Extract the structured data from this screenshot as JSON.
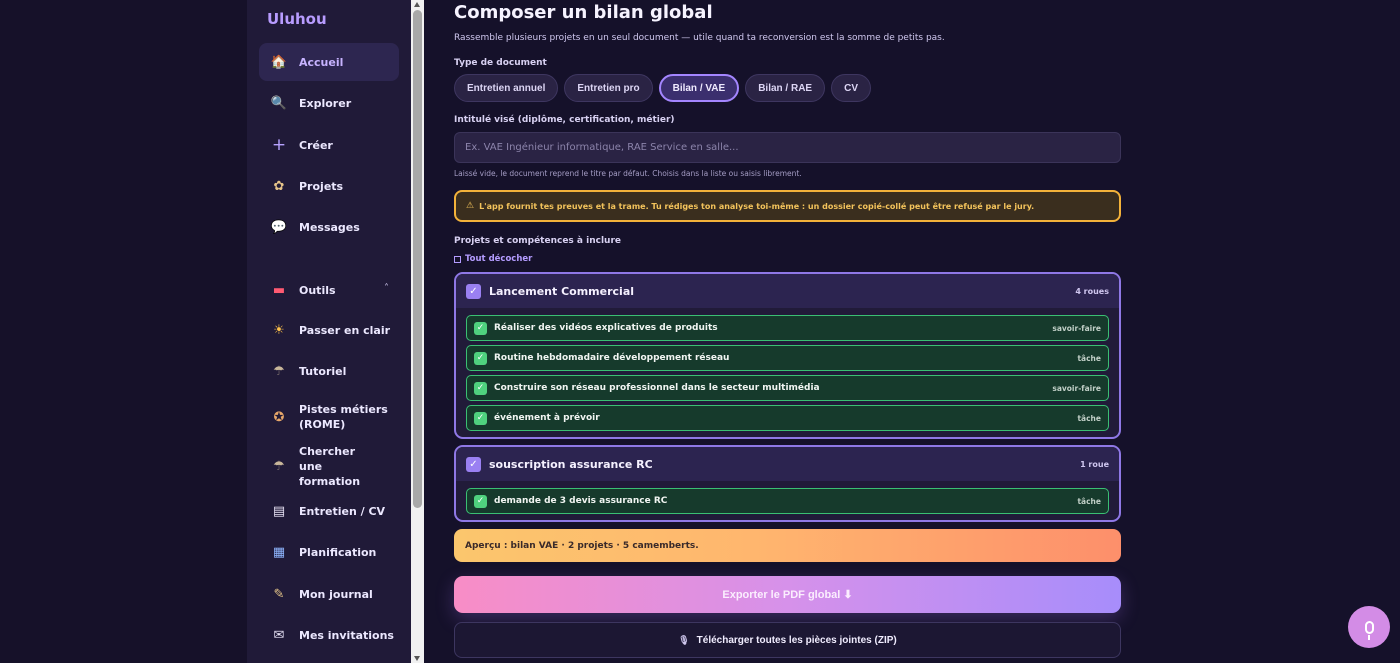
{
  "brand": "Uluhou",
  "nav": {
    "items": [
      {
        "label": "Accueil",
        "icon": "home-icon",
        "glyph": "🏠",
        "active": true
      },
      {
        "label": "Explorer",
        "icon": "magnifier-icon",
        "glyph": "🔍"
      },
      {
        "label": "Créer",
        "icon": "plus-icon",
        "glyph": "+"
      },
      {
        "label": "Projets",
        "icon": "gear-flower-icon",
        "glyph": "✿"
      },
      {
        "label": "Messages",
        "icon": "speech-bubble-icon",
        "glyph": "💬"
      }
    ],
    "tools_label": "Outils",
    "tools_caret": "˄",
    "tools": [
      {
        "label": "Passer en clair",
        "icon": "sun-icon",
        "glyph": "☀"
      },
      {
        "label": "Tutoriel",
        "icon": "lamp-icon",
        "glyph": "☂"
      },
      {
        "label": "Pistes métiers (ROME)",
        "icon": "compass-icon",
        "glyph": "✪"
      },
      {
        "label": "Chercher une formation",
        "icon": "lamp-icon",
        "glyph": "☂"
      },
      {
        "label": "Entretien / CV",
        "icon": "document-icon",
        "glyph": "▤"
      },
      {
        "label": "Planification",
        "icon": "calendar-icon",
        "glyph": "▦"
      },
      {
        "label": "Mon journal",
        "icon": "scroll-icon",
        "glyph": "✎"
      },
      {
        "label": "Mes invitations",
        "icon": "ticket-icon",
        "glyph": "✉"
      }
    ]
  },
  "page": {
    "title": "Composer un bilan global",
    "subtitle": "Rassemble plusieurs projets en un seul document — utile quand ta reconversion est la somme de petits pas."
  },
  "doc_type": {
    "label": "Type de document",
    "options": [
      "Entretien annuel",
      "Entretien pro",
      "Bilan / VAE",
      "Bilan / RAE",
      "CV"
    ],
    "selected": "Bilan / VAE"
  },
  "title_field": {
    "label": "Intitulé visé (diplôme, certification, métier)",
    "value": "",
    "placeholder": "Ex. VAE Ingénieur informatique, RAE Service en salle...",
    "hint": "Laissé vide, le document reprend le titre par défaut. Choisis dans la liste ou saisis librement."
  },
  "warning": {
    "icon": "⚠",
    "text": "L'app fournit tes preuves et la trame. Tu rédiges ton analyse toi-même : un dossier copié-collé peut être refusé par le jury."
  },
  "projects": {
    "label": "Projets et compétences à inclure",
    "toggle_all": "Tout décocher",
    "list": [
      {
        "name": "Lancement Commercial",
        "count": "4 roues",
        "checked": true,
        "items": [
          {
            "label": "Réaliser des vidéos explicatives de produits",
            "tag": "savoir-faire",
            "checked": true
          },
          {
            "label": "Routine hebdomadaire développement réseau",
            "tag": "tâche",
            "checked": true
          },
          {
            "label": "Construire son réseau professionnel dans le secteur multimédia",
            "tag": "savoir-faire",
            "checked": true
          },
          {
            "label": "événement à prévoir",
            "tag": "tâche",
            "checked": true
          }
        ]
      },
      {
        "name": "souscription assurance RC",
        "count": "1 roue",
        "checked": true,
        "items": [
          {
            "label": "demande de 3 devis assurance RC",
            "tag": "tâche",
            "checked": true
          }
        ]
      }
    ]
  },
  "preview": "Aperçu : bilan VAE · 2 projets · 5 camemberts.",
  "export_label": "Exporter le PDF global ⬇",
  "zip": {
    "icon": "🎙",
    "label": "Télécharger toutes les pièces jointes (ZIP)"
  },
  "check_glyph": "✓",
  "colors": {
    "accent": "#a486ff",
    "success": "#3ac073",
    "warning": "#f3b23a"
  }
}
